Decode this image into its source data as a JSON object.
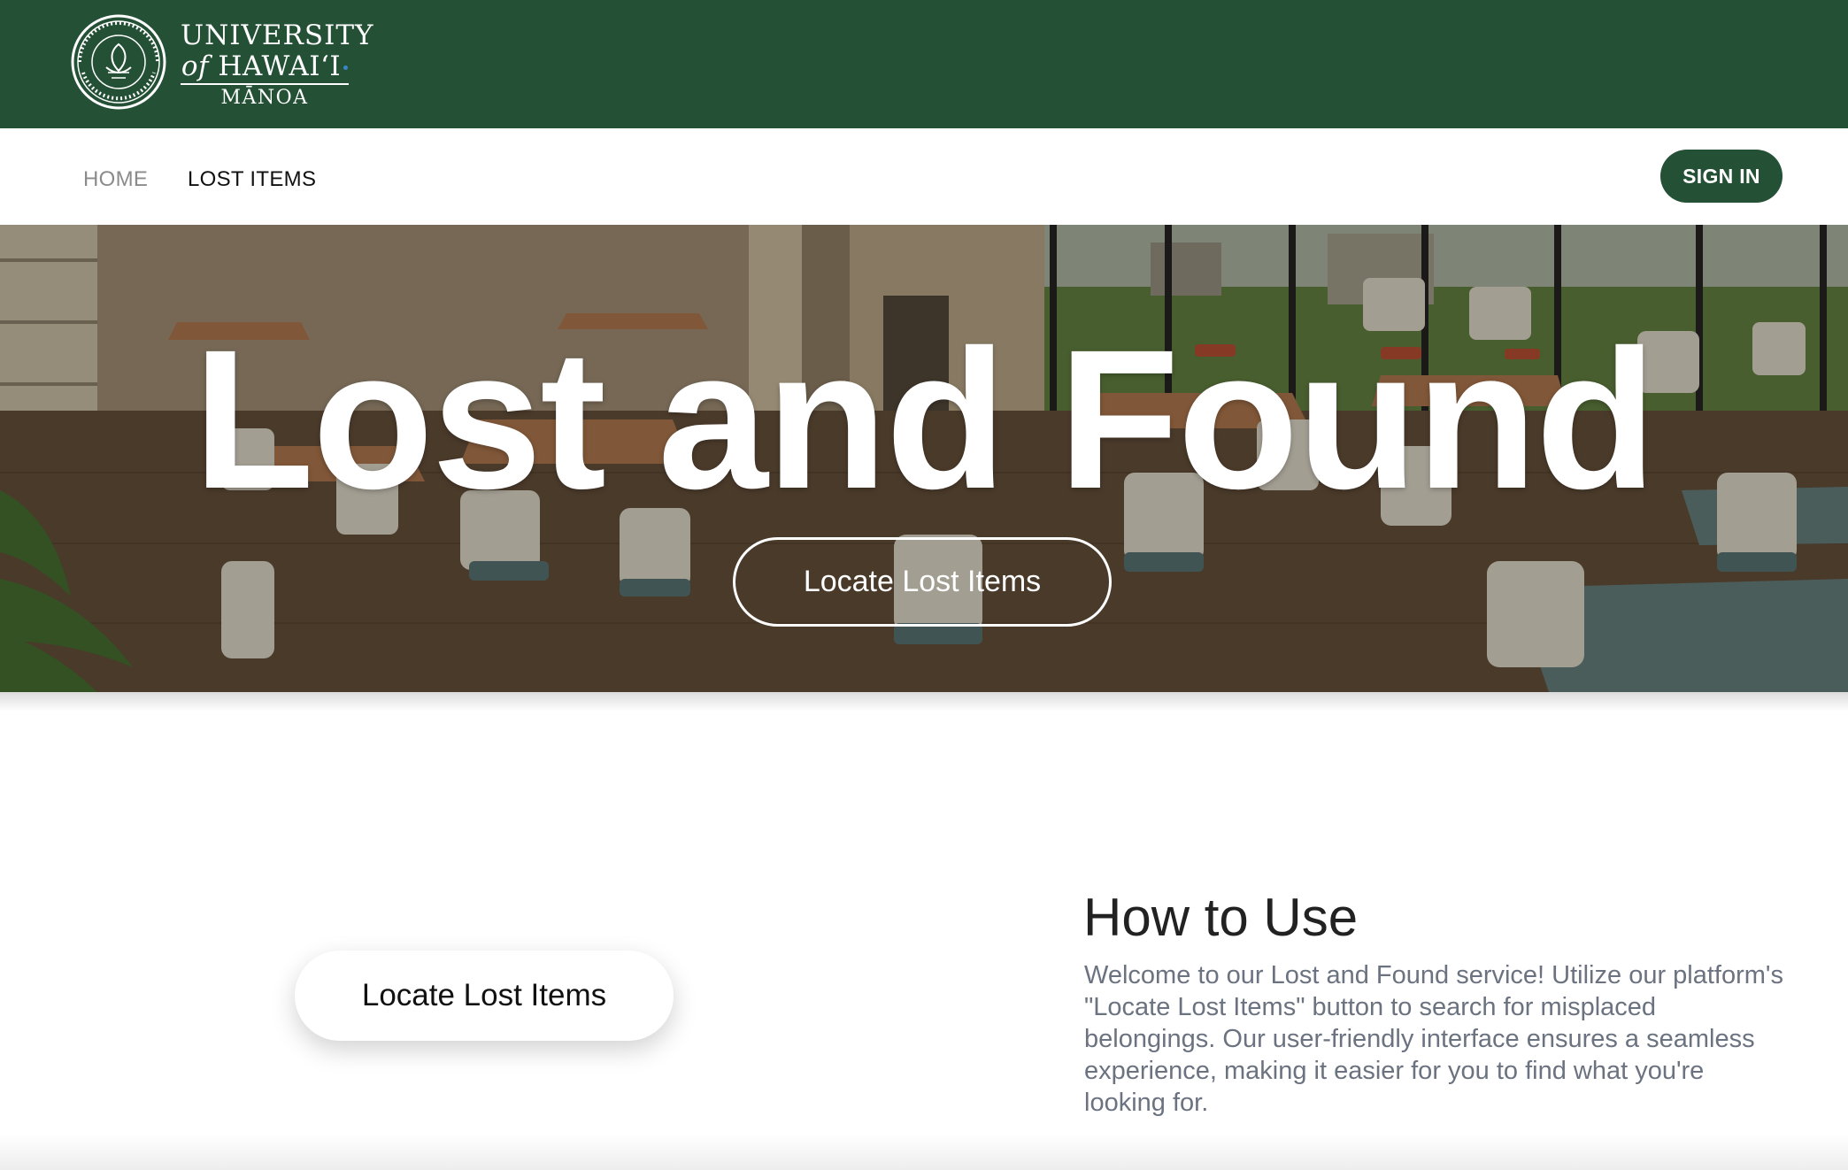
{
  "brand": {
    "line1": "UNIVERSITY",
    "line2_of": "of",
    "line2_name": "HAWAIʻI",
    "line3": "MĀNOA",
    "seal_icon": "university-seal-icon"
  },
  "nav": {
    "home": "HOME",
    "lost_items": "LOST ITEMS",
    "sign_in": "SIGN IN"
  },
  "hero": {
    "title": "Lost and Found",
    "button": "Locate Lost Items"
  },
  "main": {
    "locate_button": "Locate Lost Items",
    "howto_title": "How to Use",
    "howto_text": "Welcome to our Lost and Found service! Utilize our platform's \"Locate Lost Items\" button to search for misplaced belongings. Our user-friendly interface ensures a seamless experience, making it easier for you to find what you're looking for."
  },
  "colors": {
    "brand_green": "#245135",
    "nav_inactive": "#8b8b8b",
    "body_text": "#6b7280"
  }
}
